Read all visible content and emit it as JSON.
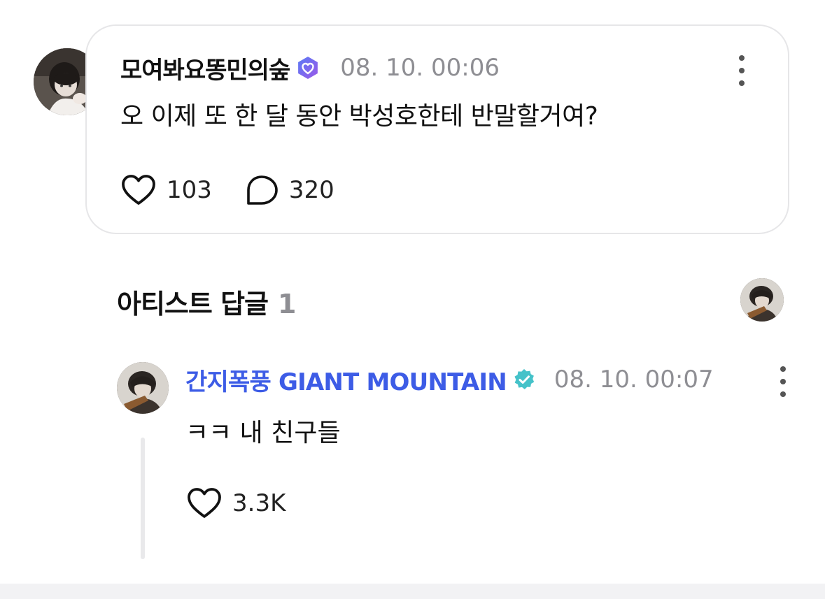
{
  "post": {
    "author": "모여봐요똥민의숲",
    "timestamp": "08. 10. 00:06",
    "text": "오 이제 또 한 달 동안 박성호한테 반말할거여?",
    "likes": "103",
    "comments": "320",
    "badge_icon": "purple-heart-badge-icon",
    "badge_color": "#7b5cf0"
  },
  "artist_replies": {
    "title": "아티스트 답글",
    "count": "1"
  },
  "reply": {
    "author": "간지폭풍 GIANT MOUNTAIN",
    "timestamp": "08. 10. 00:07",
    "text": "ㅋㅋ 내 친구들",
    "likes": "3.3K",
    "badge_icon": "teal-verified-check-icon",
    "author_color": "#3d5ce6",
    "badge_color": "#45c2c9"
  },
  "colors": {
    "meta_gray": "#8e8e93",
    "card_border": "#e6e6e8",
    "thread_line": "#e9e9eb"
  }
}
